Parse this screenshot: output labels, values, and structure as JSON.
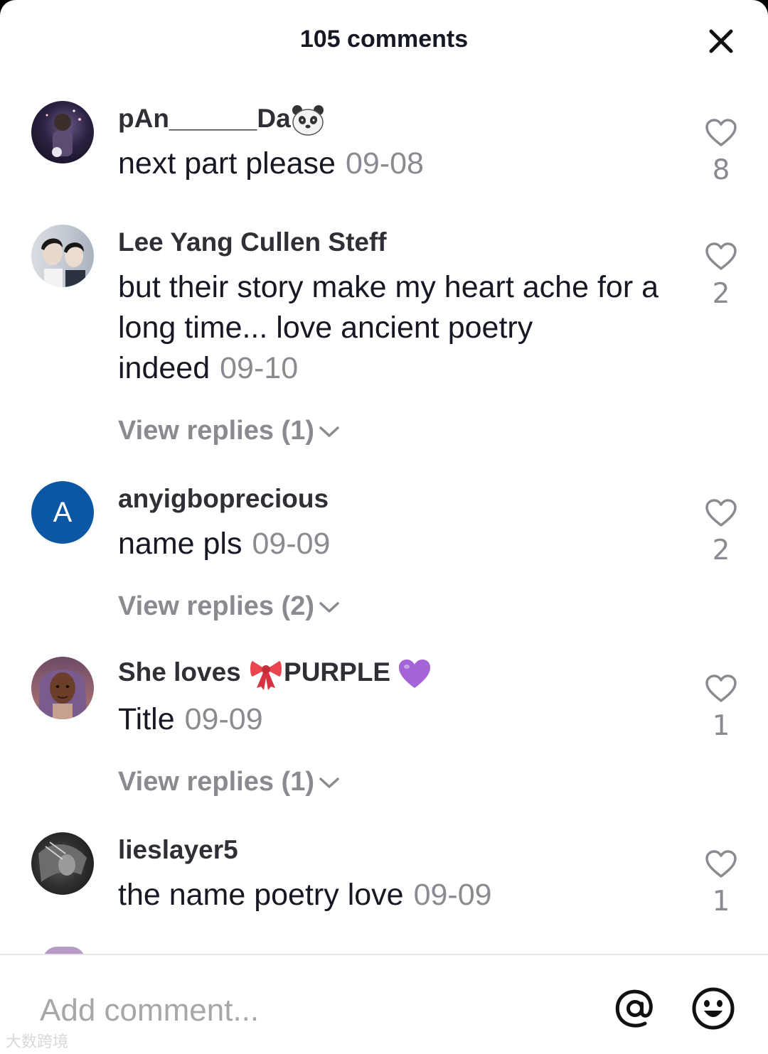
{
  "header": {
    "title": "105 comments",
    "close_icon": "close-icon"
  },
  "comments": [
    {
      "username": "pAn______Da",
      "username_emoji": "panda-face-icon",
      "text": "next part please",
      "date": "09-08",
      "likes": "8",
      "avatar": "photo-avatar"
    },
    {
      "username": "Lee Yang Cullen Steff",
      "text": "but their story make my heart ache for a long time... love ancient poetry indeed",
      "date": "09-10",
      "likes": "2",
      "replies_label": "View replies (1)",
      "avatar": "photo-avatar"
    },
    {
      "username": "anyigboprecious",
      "text": "name pls",
      "date": "09-09",
      "likes": "2",
      "replies_label": "View replies (2)",
      "avatar_letter": "A",
      "avatar_color": "#0b57a4"
    },
    {
      "username_part1": "She loves ",
      "username_part2": "PURPLE ",
      "username_emojis": [
        "ribbon-icon",
        "purple-heart-icon"
      ],
      "text": "Title",
      "date": "09-09",
      "likes": "1",
      "replies_label": "View replies (1)",
      "avatar": "photo-avatar"
    },
    {
      "username": "lieslayer5",
      "text": "the name poetry love",
      "date": "09-09",
      "likes": "1",
      "avatar": "photo-avatar"
    }
  ],
  "composer": {
    "placeholder": "Add comment...",
    "mention_icon": "at-sign-icon",
    "emoji_icon": "smiley-icon"
  },
  "watermark": "大数跨境",
  "colors": {
    "text_primary": "#161823",
    "text_secondary": "#8a8b91",
    "avatar_blue": "#0b57a4"
  }
}
